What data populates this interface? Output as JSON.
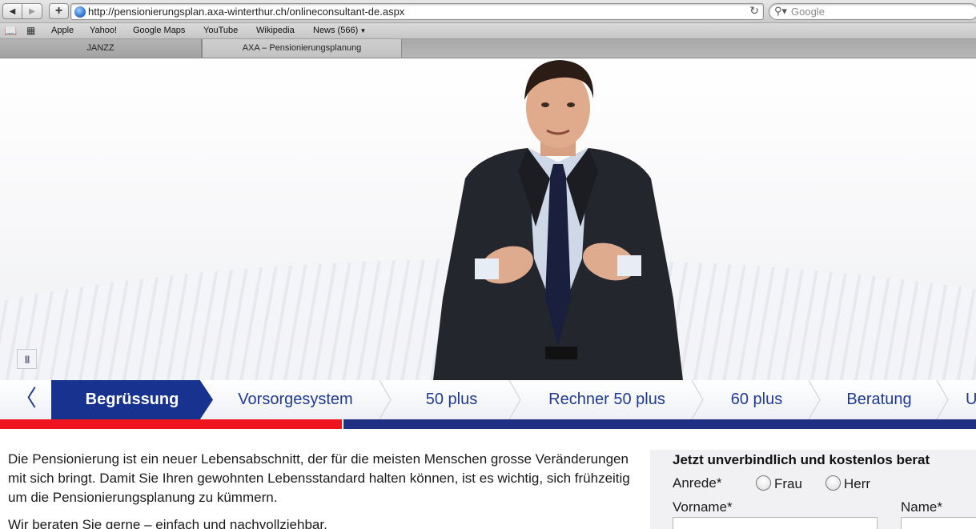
{
  "browser": {
    "url": "http://pensionierungsplan.axa-winterthur.ch/onlineconsultant-de.aspx",
    "search_placeholder": "Google",
    "bookmarks": [
      "Apple",
      "Yahoo!",
      "Google Maps",
      "YouTube",
      "Wikipedia",
      "News (566)"
    ],
    "tabs": [
      {
        "label": "JANZZ",
        "active": false
      },
      {
        "label": "AXA – Pensionierungsplanung",
        "active": true
      }
    ]
  },
  "video": {
    "pause_icon": "pause-icon",
    "pause_glyph": "II"
  },
  "steps": {
    "prev_glyph": "〈",
    "items": [
      "Begrüssung",
      "Vorsorgesystem",
      "50 plus",
      "Rechner 50 plus",
      "60 plus",
      "Beratung",
      "U"
    ],
    "active_index": 0,
    "progress_fraction": 0.35,
    "colors": {
      "active": "#18338f",
      "text": "#1f3a93",
      "progress_red": "#f0141e",
      "progress_blue": "#1e2f84"
    }
  },
  "intro": {
    "paragraph1": "Die Pensionierung ist ein neuer Lebensabschnitt, der für die meisten Menschen grosse Veränderungen mit sich bringt. Damit Sie Ihren gewohnten Lebensstandard halten können, ist es wichtig, sich frühzeitig um die Pensionierungsplanung zu kümmern.",
    "paragraph2": "Wir beraten Sie gerne – einfach und nachvollziehbar."
  },
  "form": {
    "title": "Jetzt unverbindlich und kostenlos berat",
    "anrede_label": "Anrede*",
    "option_frau": "Frau",
    "option_herr": "Herr",
    "vorname_label": "Vorname*",
    "name_label": "Name*"
  }
}
